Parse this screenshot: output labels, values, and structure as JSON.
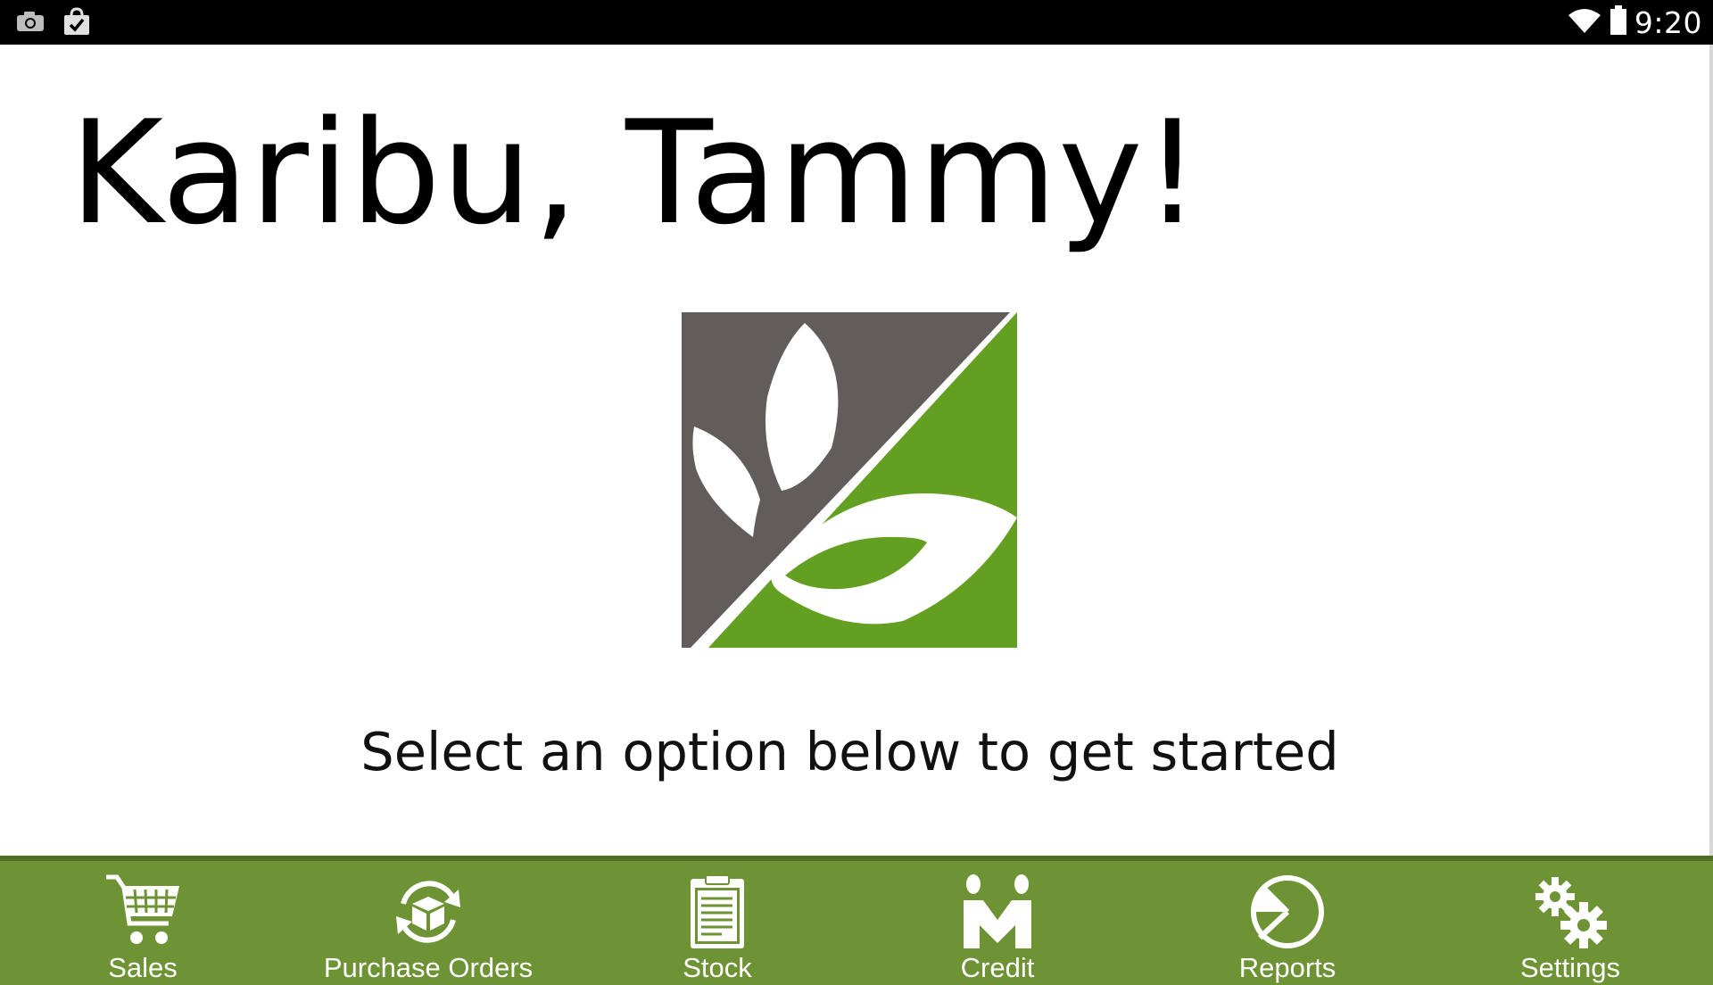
{
  "status_bar": {
    "left_icons": [
      "camera-icon",
      "shopping-bag-check-icon"
    ],
    "right_icons": [
      "wifi-icon",
      "battery-icon"
    ],
    "time": "9:20"
  },
  "main": {
    "greeting": "Karibu, Tammy!",
    "logo": "leaf-logo",
    "subtitle": "Select an option below to get started"
  },
  "bottom_nav": {
    "items": [
      {
        "label": "Sales",
        "icon": "shopping-cart-icon"
      },
      {
        "label": "Purchase Orders",
        "icon": "box-cycle-icon"
      },
      {
        "label": "Stock",
        "icon": "clipboard-icon"
      },
      {
        "label": "Credit",
        "icon": "handshake-people-icon"
      },
      {
        "label": "Reports",
        "icon": "pie-chart-icon"
      },
      {
        "label": "Settings",
        "icon": "gears-icon"
      }
    ]
  },
  "colors": {
    "nav_green": "#6d9334",
    "logo_green": "#63a022",
    "logo_gray": "#625d5b"
  }
}
